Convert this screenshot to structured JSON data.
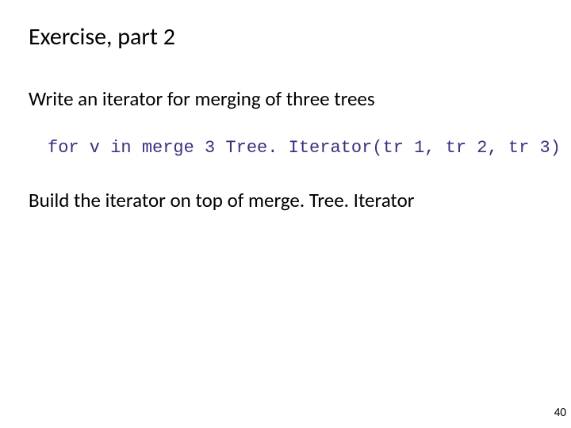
{
  "slide": {
    "title": "Exercise, part 2",
    "line1": "Write an iterator for merging of three trees",
    "code": "for v in merge 3 Tree. Iterator(tr 1, tr 2, tr 3)",
    "line2": "Build the iterator on top of merge. Tree. Iterator",
    "pageNumber": "40"
  }
}
